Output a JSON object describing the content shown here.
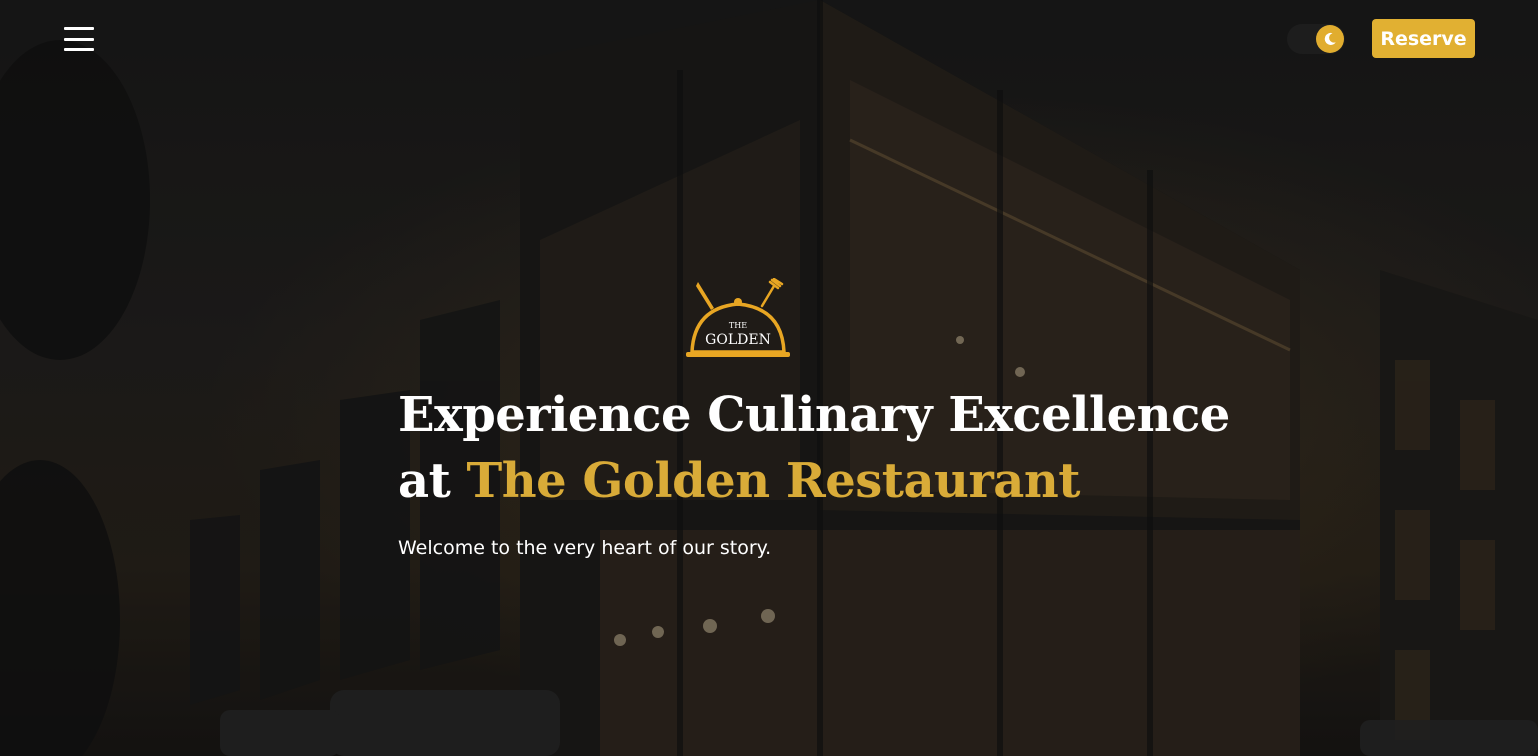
{
  "header": {
    "menu_icon": "hamburger-menu-icon",
    "theme_toggle_icon": "moon-icon",
    "reserve_label": "Reserve"
  },
  "hero": {
    "logo_text_top": "THE",
    "logo_text_bottom": "GOLDEN",
    "headline_line1": "Experience Culinary Excellence",
    "headline_at": "at",
    "headline_highlight": "The Golden Restaurant",
    "subtitle": "Welcome to the very heart of our story."
  },
  "colors": {
    "accent": "#e1b032",
    "headline_highlight": "#d9ab38",
    "text": "#ffffff"
  }
}
